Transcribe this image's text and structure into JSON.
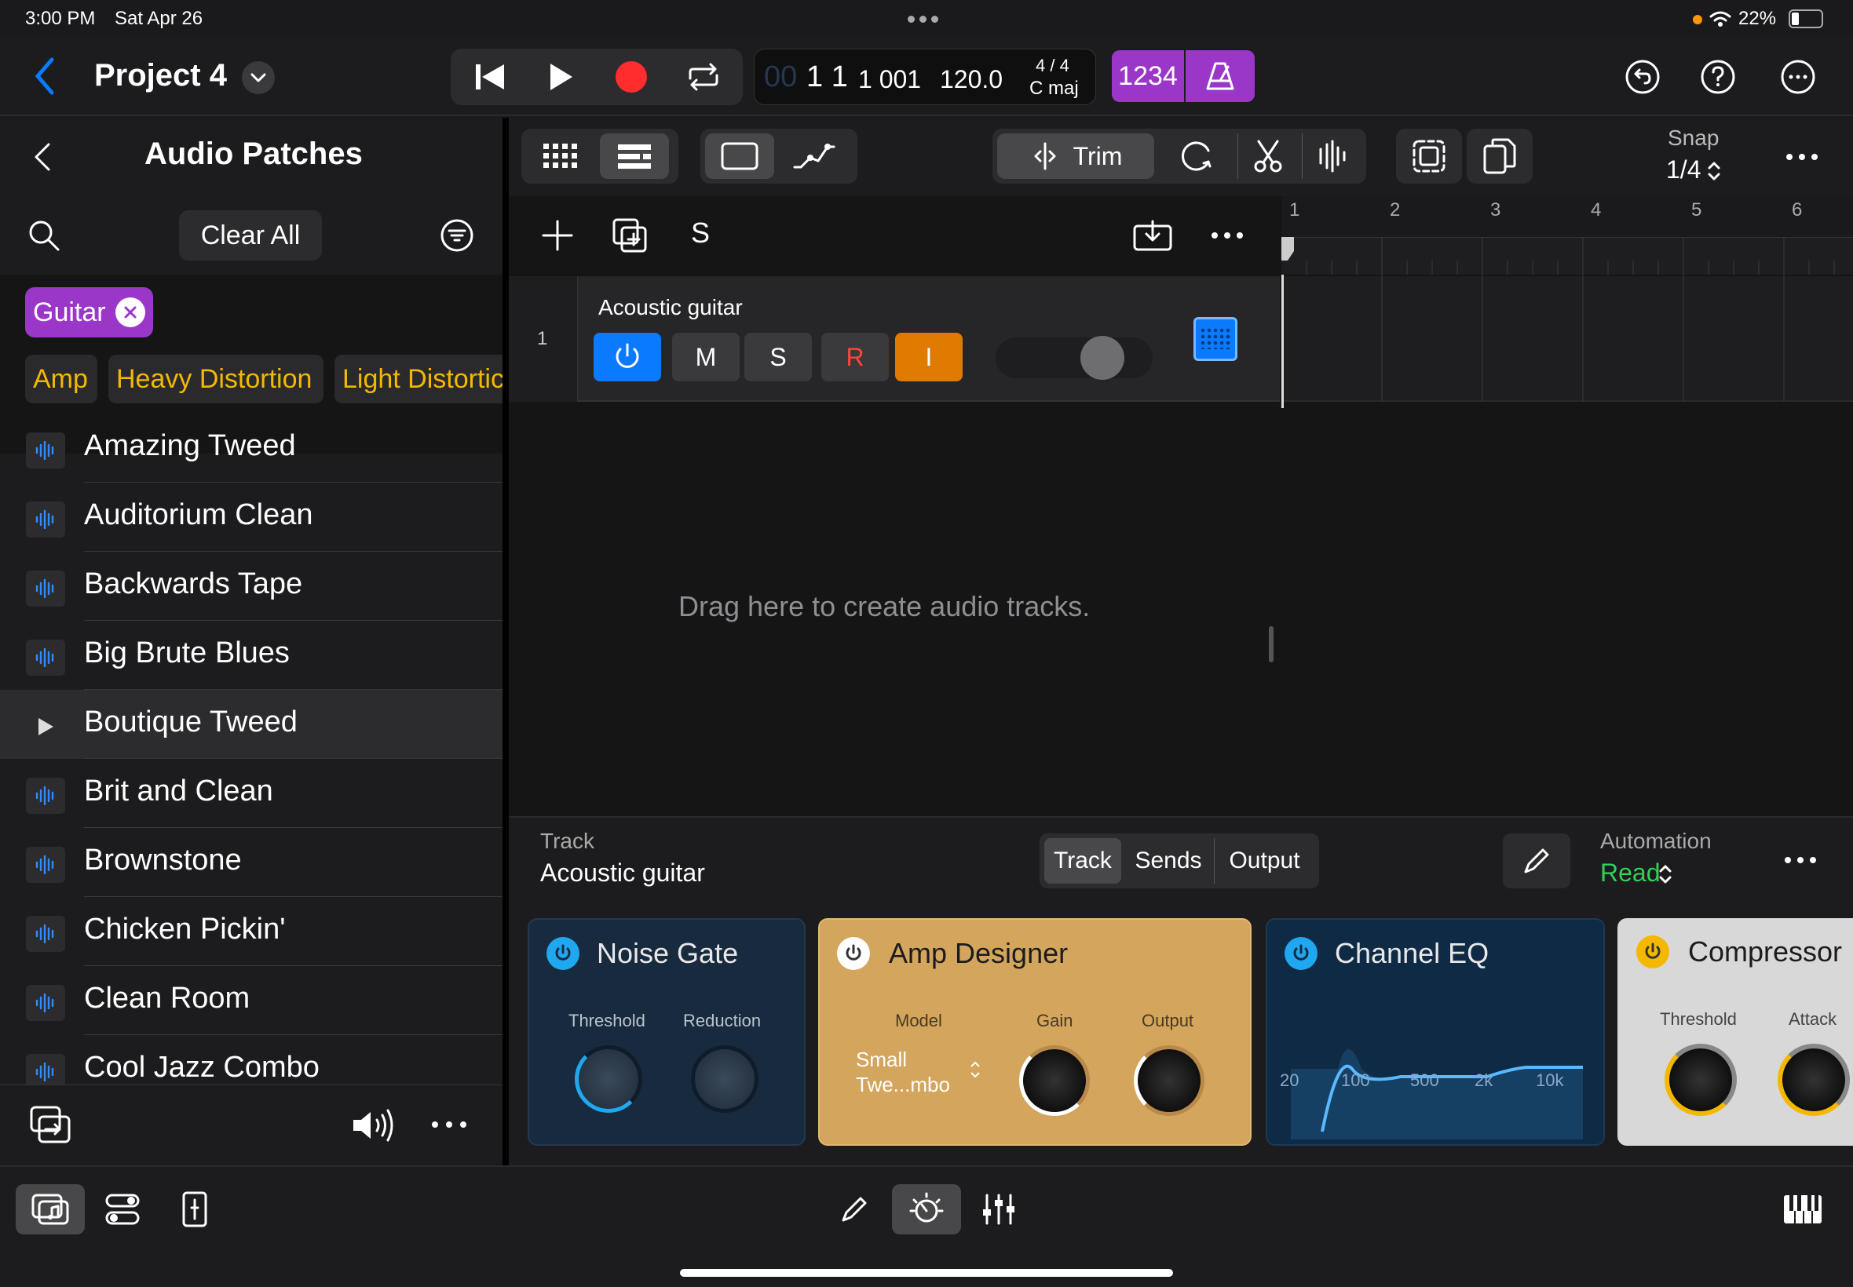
{
  "status": {
    "time": "3:00 PM",
    "date": "Sat Apr 26",
    "battery": "22%"
  },
  "header": {
    "project_title": "Project 4",
    "lcd": {
      "dim_prefix": "00",
      "bar": "1 1",
      "beat": "1 001",
      "tempo": "120.0",
      "signature": "4 / 4",
      "key": "C maj"
    },
    "count_in": "1234"
  },
  "sidebar": {
    "title": "Audio Patches",
    "clear_all": "Clear All",
    "active_filter": "Guitar",
    "tags": [
      "Amp",
      "Heavy Distortion",
      "Light Distortic"
    ],
    "items": [
      "Amazing Tweed",
      "Auditorium Clean",
      "Backwards Tape",
      "Big Brute Blues",
      "Boutique Tweed",
      "Brit and Clean",
      "Brownstone",
      "Chicken Pickin'",
      "Clean Room",
      "Cool Jazz Combo"
    ],
    "selected_index": 4
  },
  "toolbar": {
    "trim_label": "Trim",
    "snap_label": "Snap",
    "snap_value": "1/4"
  },
  "tracks_header": {
    "solo_label": "S"
  },
  "track": {
    "number": "1",
    "name": "Acoustic guitar",
    "mute": "M",
    "solo": "S",
    "record": "R",
    "input": "I"
  },
  "ruler": {
    "marks": [
      "1",
      "2",
      "3",
      "4",
      "5",
      "6"
    ]
  },
  "empty_hint": "Drag here to create audio tracks.",
  "inspector": {
    "section_label": "Track",
    "track_name": "Acoustic guitar",
    "tabs": [
      "Track",
      "Sends",
      "Output"
    ],
    "automation_label": "Automation",
    "automation_value": "Read"
  },
  "plugins": {
    "noise_gate": {
      "title": "Noise Gate",
      "params": [
        "Threshold",
        "Reduction"
      ]
    },
    "amp_designer": {
      "title": "Amp Designer",
      "params": [
        "Model",
        "Gain",
        "Output"
      ],
      "model_value": "Small Twe...mbo"
    },
    "channel_eq": {
      "title": "Channel EQ",
      "freqs": [
        "20",
        "100",
        "500",
        "2k",
        "10k"
      ]
    },
    "compressor": {
      "title": "Compressor",
      "params": [
        "Threshold",
        "Attack"
      ]
    }
  },
  "colors": {
    "accent_blue": "#0a7aff",
    "record_red": "#ff2d2d",
    "input_orange": "#e07a00",
    "purple": "#9b37c8",
    "tag_yellow": "#f5b800",
    "amp_gold": "#d4a55c",
    "eq_blue": "#0e2a45"
  }
}
